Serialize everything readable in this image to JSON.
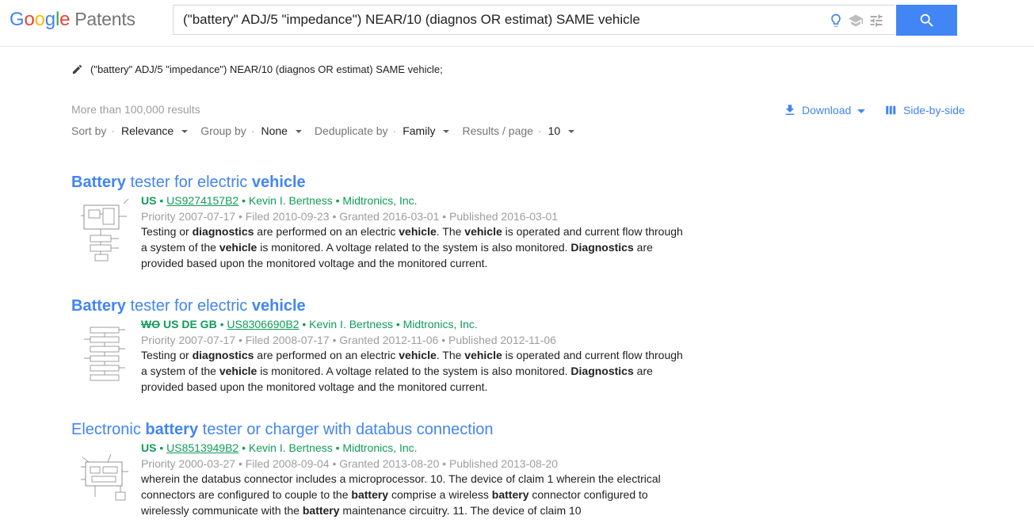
{
  "logo": {
    "google": "Google",
    "product": "Patents"
  },
  "search": {
    "query": "(\"battery\" ADJ/5 \"impedance\") NEAR/10 (diagnos OR estimat) SAME vehicle"
  },
  "query_line": "(\"battery\" ADJ/5 \"impedance\") NEAR/10 (diagnos OR estimat) SAME vehicle;",
  "results_count": "More than 100,000 results",
  "toolbar": {
    "sort_label": "Sort by",
    "sort_value": "Relevance",
    "group_label": "Group by",
    "group_value": "None",
    "dedup_label": "Deduplicate by",
    "dedup_value": "Family",
    "rpp_label": "Results / page",
    "rpp_value": "10",
    "separator": "·"
  },
  "actions": {
    "download": "Download",
    "side_by_side": "Side-by-side"
  },
  "colors": {
    "accent": "#4285f4",
    "green": "#0f9d58",
    "grey": "#9e9e9e"
  },
  "results": [
    {
      "title": [
        {
          "t": "Battery",
          "b": true
        },
        {
          "t": " tester for electric ",
          "b": false
        },
        {
          "t": "vehicle",
          "b": true
        }
      ],
      "countries": "US",
      "countries_struck": "",
      "patent": "US9274157B2",
      "inventor": "Kevin I. Bertness",
      "assignee": "Midtronics, Inc.",
      "dates": "Priority 2007-07-17 • Filed 2010-09-23 • Granted 2016-03-01 • Published 2016-03-01",
      "snippet_lines": [
        [
          {
            "t": "Testing or ",
            "b": false
          },
          {
            "t": "diagnostics",
            "b": true
          },
          {
            "t": " are performed on an electric ",
            "b": false
          },
          {
            "t": "vehicle",
            "b": true
          },
          {
            "t": ". The ",
            "b": false
          },
          {
            "t": "vehicle",
            "b": true
          },
          {
            "t": " is operated and current flow through",
            "b": false
          }
        ],
        [
          {
            "t": "a system of the ",
            "b": false
          },
          {
            "t": "vehicle",
            "b": true
          },
          {
            "t": " is monitored. A voltage related to the system is also monitored. ",
            "b": false
          },
          {
            "t": "Diagnostics",
            "b": true
          },
          {
            "t": " are",
            "b": false
          }
        ],
        [
          {
            "t": "provided based upon the monitored voltage and the monitored current.",
            "b": false
          }
        ]
      ]
    },
    {
      "title": [
        {
          "t": "Battery",
          "b": true
        },
        {
          "t": " tester for electric ",
          "b": false
        },
        {
          "t": "vehicle",
          "b": true
        }
      ],
      "countries": "US DE GB",
      "countries_struck": "WO",
      "patent": "US8306690B2",
      "inventor": "Kevin I. Bertness",
      "assignee": "Midtronics, Inc.",
      "dates": "Priority 2007-07-17 • Filed 2008-07-17 • Granted 2012-11-06 • Published 2012-11-06",
      "snippet_lines": [
        [
          {
            "t": "Testing or ",
            "b": false
          },
          {
            "t": "diagnostics",
            "b": true
          },
          {
            "t": " are performed on an electric ",
            "b": false
          },
          {
            "t": "vehicle",
            "b": true
          },
          {
            "t": ". The ",
            "b": false
          },
          {
            "t": "vehicle",
            "b": true
          },
          {
            "t": " is operated and current flow through",
            "b": false
          }
        ],
        [
          {
            "t": "a system of the ",
            "b": false
          },
          {
            "t": "vehicle",
            "b": true
          },
          {
            "t": " is monitored. A voltage related to the system is also monitored. ",
            "b": false
          },
          {
            "t": "Diagnostics",
            "b": true
          },
          {
            "t": " are",
            "b": false
          }
        ],
        [
          {
            "t": "provided based upon the monitored voltage and the monitored current.",
            "b": false
          }
        ]
      ]
    },
    {
      "title": [
        {
          "t": "Electronic ",
          "b": false
        },
        {
          "t": "battery",
          "b": true
        },
        {
          "t": " tester or charger with databus connection",
          "b": false
        }
      ],
      "countries": "US",
      "countries_struck": "",
      "patent": "US8513949B2",
      "inventor": "Kevin I. Bertness",
      "assignee": "Midtronics, Inc.",
      "dates": "Priority 2000-03-27 • Filed 2008-09-04 • Granted 2013-08-20 • Published 2013-08-20",
      "snippet_lines": [
        [
          {
            "t": "wherein the databus connector includes a microprocessor. 10. The device of claim 1 wherein the electrical",
            "b": false
          }
        ],
        [
          {
            "t": "connectors are configured to couple to the ",
            "b": false
          },
          {
            "t": "battery",
            "b": true
          },
          {
            "t": " comprise a wireless ",
            "b": false
          },
          {
            "t": "battery",
            "b": true
          },
          {
            "t": " connector configured to",
            "b": false
          }
        ],
        [
          {
            "t": "wirelessly communicate with the ",
            "b": false
          },
          {
            "t": "battery",
            "b": true
          },
          {
            "t": " maintenance circuitry. 11. The device of claim 10",
            "b": false
          }
        ]
      ]
    }
  ]
}
